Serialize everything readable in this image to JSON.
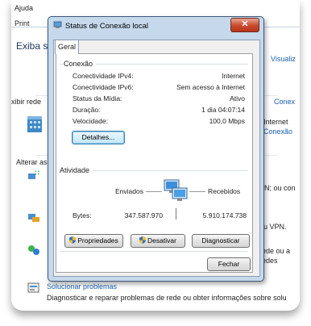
{
  "background_window": {
    "menu": [
      "Ajuda",
      "Print"
    ],
    "heading": "Exiba su",
    "link_right": "Visualiz",
    "left_exibir": "xibir rede",
    "conexao_link": "Conex",
    "internet_label": "Internet",
    "conexao_link2": "Conexão",
    "alterar": "Alterar as",
    "item_vpn1": "PN; ou con",
    "item_vpn2": "ou VPN.",
    "item_redes": "rede ou a",
    "item_redes2": "redes",
    "solucionar_title": "Solucionar problemas",
    "solucionar_desc": "Diagnosticar e reparar problemas de rede ou obter informações sobre solu"
  },
  "dialog": {
    "title": "Status de Conexão local",
    "close_label": "✕",
    "tab_label": "Geral",
    "conexao_group": "Conexão",
    "rows": [
      {
        "label": "Conectividade IPv4:",
        "value": "Internet"
      },
      {
        "label": "Conectividade IPv6:",
        "value": "Sem acesso à Internet"
      },
      {
        "label": "Status da Mídia:",
        "value": "Ativo"
      },
      {
        "label": "Duração:",
        "value": "1 dia 04:07:14"
      },
      {
        "label": "Velocidade:",
        "value": "100,0 Mbps"
      }
    ],
    "detalhes_button": "Detalhes...",
    "atividade_group": "Atividade",
    "enviados_label": "Enviados",
    "recebidos_label": "Recebidos",
    "bytes_label": "Bytes:",
    "bytes_sent": "347.587.970",
    "bytes_received": "5.910.174.738",
    "propriedades_button": "Propriedades",
    "desativar_button": "Desativar",
    "diagnosticar_button": "Diagnosticar",
    "fechar_button": "Fechar"
  },
  "colors": {
    "link_blue": "#1a5fb4",
    "close_red": "#c84a2e",
    "dialog_frame": "#c6d9ec"
  }
}
